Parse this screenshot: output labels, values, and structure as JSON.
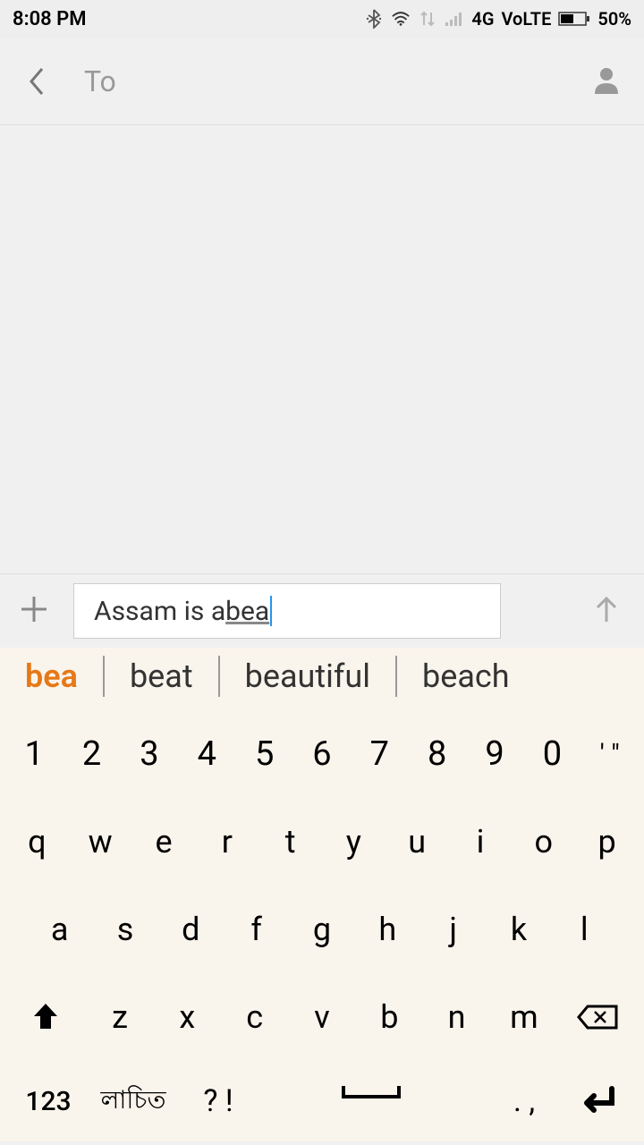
{
  "status": {
    "time": "8:08 PM",
    "network": "4G",
    "volte": "VoLTE",
    "battery": "50%"
  },
  "header": {
    "to_label": "To"
  },
  "input": {
    "text_plain": "Assam is a ",
    "text_underlined": "bea"
  },
  "suggestions": [
    "bea",
    "beat",
    "beautiful",
    "beach"
  ],
  "keyboard": {
    "row_num": [
      "1",
      "2",
      "3",
      "4",
      "5",
      "6",
      "7",
      "8",
      "9",
      "0",
      "' \""
    ],
    "row1": [
      "q",
      "w",
      "e",
      "r",
      "t",
      "y",
      "u",
      "i",
      "o",
      "p"
    ],
    "row2": [
      "a",
      "s",
      "d",
      "f",
      "g",
      "h",
      "j",
      "k",
      "l"
    ],
    "row3": [
      "z",
      "x",
      "c",
      "v",
      "b",
      "n",
      "m"
    ],
    "numkey": "123",
    "lang": "লাচিত",
    "punct1": "? !",
    "punct2": ". ,"
  }
}
